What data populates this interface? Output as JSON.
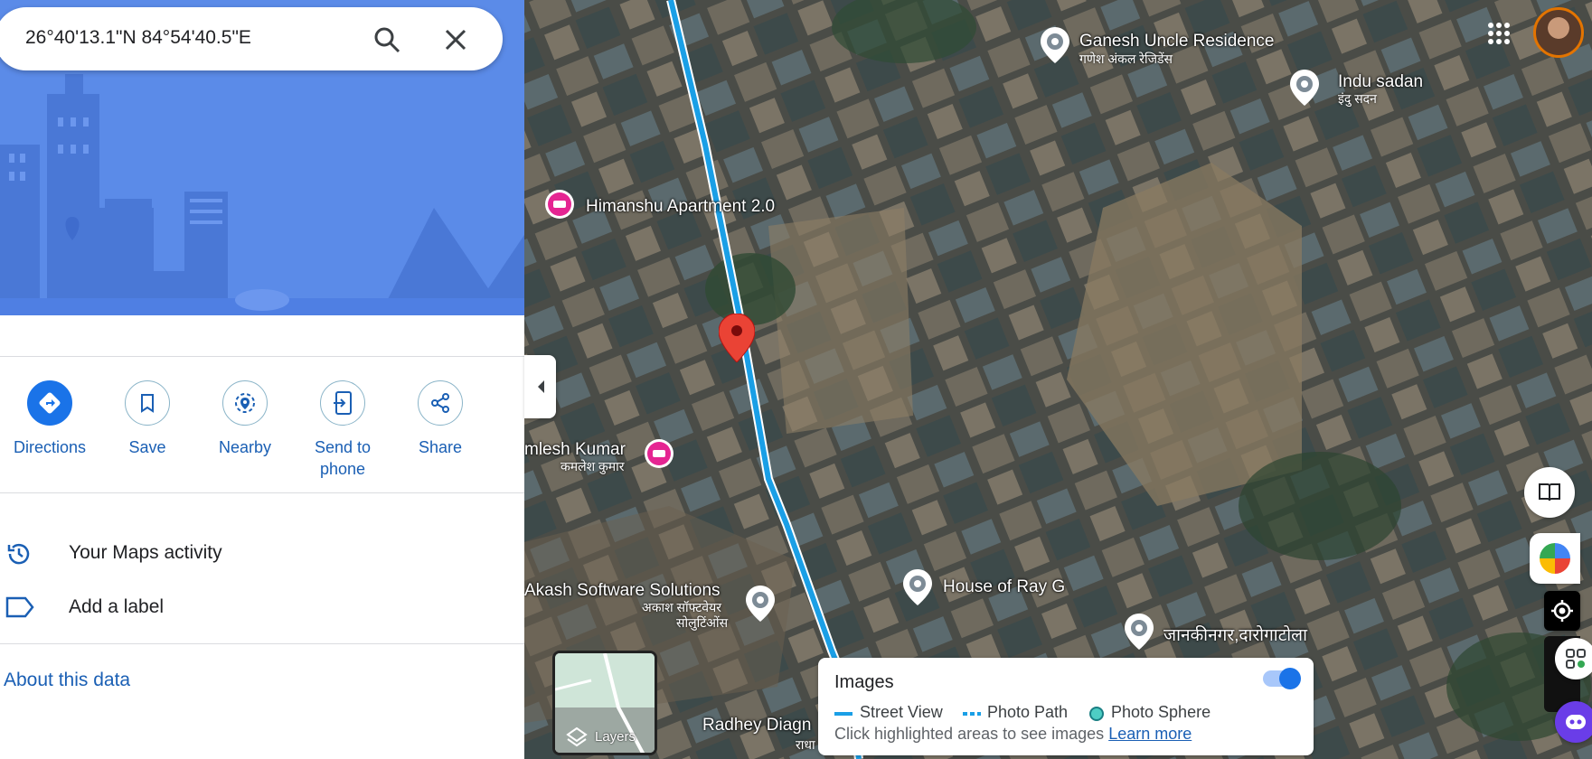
{
  "search": {
    "query": "26°40'13.1\"N 84°54'40.5\"E"
  },
  "actions": [
    {
      "label": "Directions"
    },
    {
      "label": "Save"
    },
    {
      "label": "Nearby"
    },
    {
      "label": "Send to phone"
    },
    {
      "label": "Share"
    }
  ],
  "rows": {
    "activity": "Your Maps activity",
    "label": "Add a label"
  },
  "about": "About this data",
  "map": {
    "places": {
      "ganesh": {
        "name": "Ganesh Uncle Residence",
        "sub": "गणेश अंकल रेजिडेंस"
      },
      "indu": {
        "name": "Indu sadan",
        "sub": "इंदु सदन"
      },
      "himanshu": {
        "name": "Himanshu Apartment 2.0"
      },
      "kamlesh": {
        "name": "mlesh Kumar",
        "sub": "कमलेश कुमार"
      },
      "akash": {
        "name": "Akash Software Solutions",
        "sub1": "अकाश सॉफ्टवेयर",
        "sub2": "सोलुटिंओंस"
      },
      "house": {
        "name": "House of Ray G"
      },
      "janaki": {
        "name": "जानकीनगर,दारोगाटोला"
      },
      "radhey": {
        "name": "Radhey Diagn",
        "sub": "राधा"
      }
    },
    "layers_label": "Layers"
  },
  "images_panel": {
    "title": "Images",
    "street_view": "Street View",
    "photo_path": "Photo Path",
    "photo_sphere": "Photo Sphere",
    "hint": "Click highlighted areas to see images",
    "learn_more": "Learn more",
    "toggle_on": true
  },
  "colors": {
    "accent": "#1a73e8",
    "link": "#1a5fb4",
    "hero": "#4f80e6",
    "route": "#1a9fe6",
    "pin_red": "#ea4335",
    "hotel_pink": "#e52592"
  },
  "icons": [
    "search-icon",
    "close-icon",
    "directions-icon",
    "bookmark-icon",
    "nearby-icon",
    "send-to-phone-icon",
    "share-icon",
    "history-icon",
    "label-icon",
    "collapse-chevron-icon",
    "apps-grid-icon",
    "avatar",
    "layers-icon",
    "book-icon",
    "location-icon"
  ]
}
